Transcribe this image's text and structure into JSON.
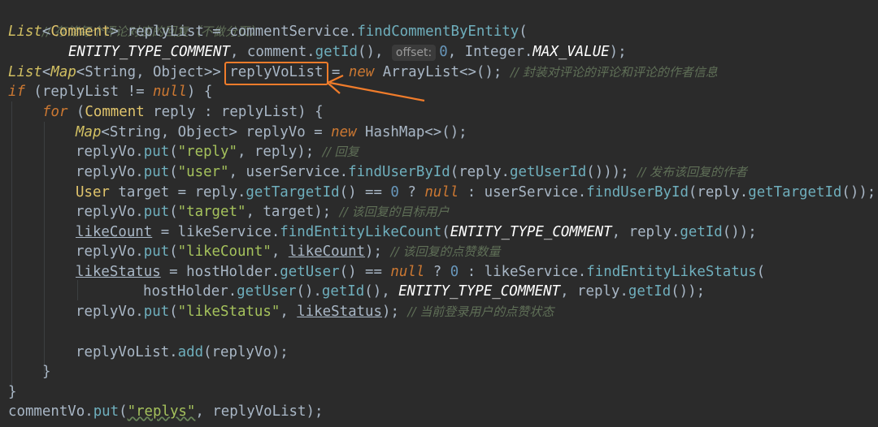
{
  "code": {
    "l1_comment": "// 存储每个评论对应的回复（不做分页）",
    "l2": {
      "t1": "List",
      "t2": "<",
      "t3": "Comment",
      "t4": "> replyList = commentService.",
      "m1": "findCommentByEntity",
      "t5": "("
    },
    "l3": {
      "c1": "ENTITY_TYPE_COMMENT",
      "t1": ", comment.",
      "m1": "getId",
      "t2": "(), ",
      "hint": "offset:",
      "n1": "0",
      "t3": ", Integer.",
      "c2": "MAX_VALUE",
      "t4": ");"
    },
    "l4": {
      "t1": "List",
      "t2": "<",
      "t3": "Map",
      "t4": "<String, Object>> ",
      "var": "replyVoList",
      "t5": " = ",
      "k1": "new",
      "t6": " ArrayList<>();",
      "cmt": "// 封装对评论的评论和评论的作者信息"
    },
    "l5": {
      "k1": "if",
      "t1": " (replyList != ",
      "k2": "null",
      "t2": ") {"
    },
    "l6": {
      "k1": "for",
      "t1": " (",
      "ty": "Comment",
      "t2": " reply : replyList) {"
    },
    "l7": {
      "t1": "Map",
      "t2": "<String, Object> replyVo = ",
      "k1": "new",
      "t3": " HashMap<>();"
    },
    "l8": {
      "t1": "replyVo.",
      "m1": "put",
      "t2": "(",
      "s1": "\"reply\"",
      "t3": ", reply); ",
      "cmt": "// 回复"
    },
    "l9": {
      "t1": "replyVo.",
      "m1": "put",
      "t2": "(",
      "s1": "\"user\"",
      "t3": ", userService.",
      "m2": "findUserById",
      "t4": "(reply.",
      "m3": "getUserId",
      "t5": "())); ",
      "cmt": "// 发布该回复的作者"
    },
    "l10": {
      "ty": "User",
      "t1": " target = reply.",
      "m1": "getTargetId",
      "t2": "() == ",
      "n1": "0",
      "t3": " ? ",
      "k1": "null",
      "t4": " : userService.",
      "m2": "findUserById",
      "t5": "(reply.",
      "m3": "getTargetId",
      "t6": "());"
    },
    "l11": {
      "t1": "replyVo.",
      "m1": "put",
      "t2": "(",
      "s1": "\"target\"",
      "t3": ", target); ",
      "cmt": "// 该回复的目标用户"
    },
    "l12": {
      "v1": "likeCount",
      "t1": " = likeService.",
      "m1": "findEntityLikeCount",
      "t2": "(",
      "c1": "ENTITY_TYPE_COMMENT",
      "t3": ", reply.",
      "m2": "getId",
      "t4": "());"
    },
    "l13": {
      "t1": "replyVo.",
      "m1": "put",
      "t2": "(",
      "s1": "\"likeCount\"",
      "t3": ", ",
      "v1": "likeCount",
      "t4": "); ",
      "cmt": "// 该回复的点赞数量"
    },
    "l14": {
      "v1": "likeStatus",
      "t1": " = hostHolder.",
      "m1": "getUser",
      "t2": "() == ",
      "k1": "null",
      "t3": " ? ",
      "n1": "0",
      "t4": " : likeService.",
      "m2": "findEntityLikeStatus",
      "t5": "("
    },
    "l15": {
      "t1": "hostHolder.",
      "m1": "getUser",
      "t2": "().",
      "m2": "getId",
      "t3": "(), ",
      "c1": "ENTITY_TYPE_COMMENT",
      "t4": ", reply.",
      "m3": "getId",
      "t5": "());"
    },
    "l16": {
      "t1": "replyVo.",
      "m1": "put",
      "t2": "(",
      "s1": "\"likeStatus\"",
      "t3": ", ",
      "v1": "likeStatus",
      "t4": "); ",
      "cmt": "// 当前登录用户的点赞状态"
    },
    "l18": {
      "t1": "replyVoList.",
      "m1": "add",
      "t2": "(replyVo);"
    },
    "l19": {
      "t1": "}"
    },
    "l20": {
      "t1": "}"
    },
    "l21": {
      "t1": "commentVo.",
      "m1": "put",
      "t2": "(",
      "s1": "\"replys\"",
      "t3": ", replyVoList);"
    }
  },
  "colors": {
    "highlight_box": "#f07c2b",
    "arrow": "#f07c2b"
  }
}
